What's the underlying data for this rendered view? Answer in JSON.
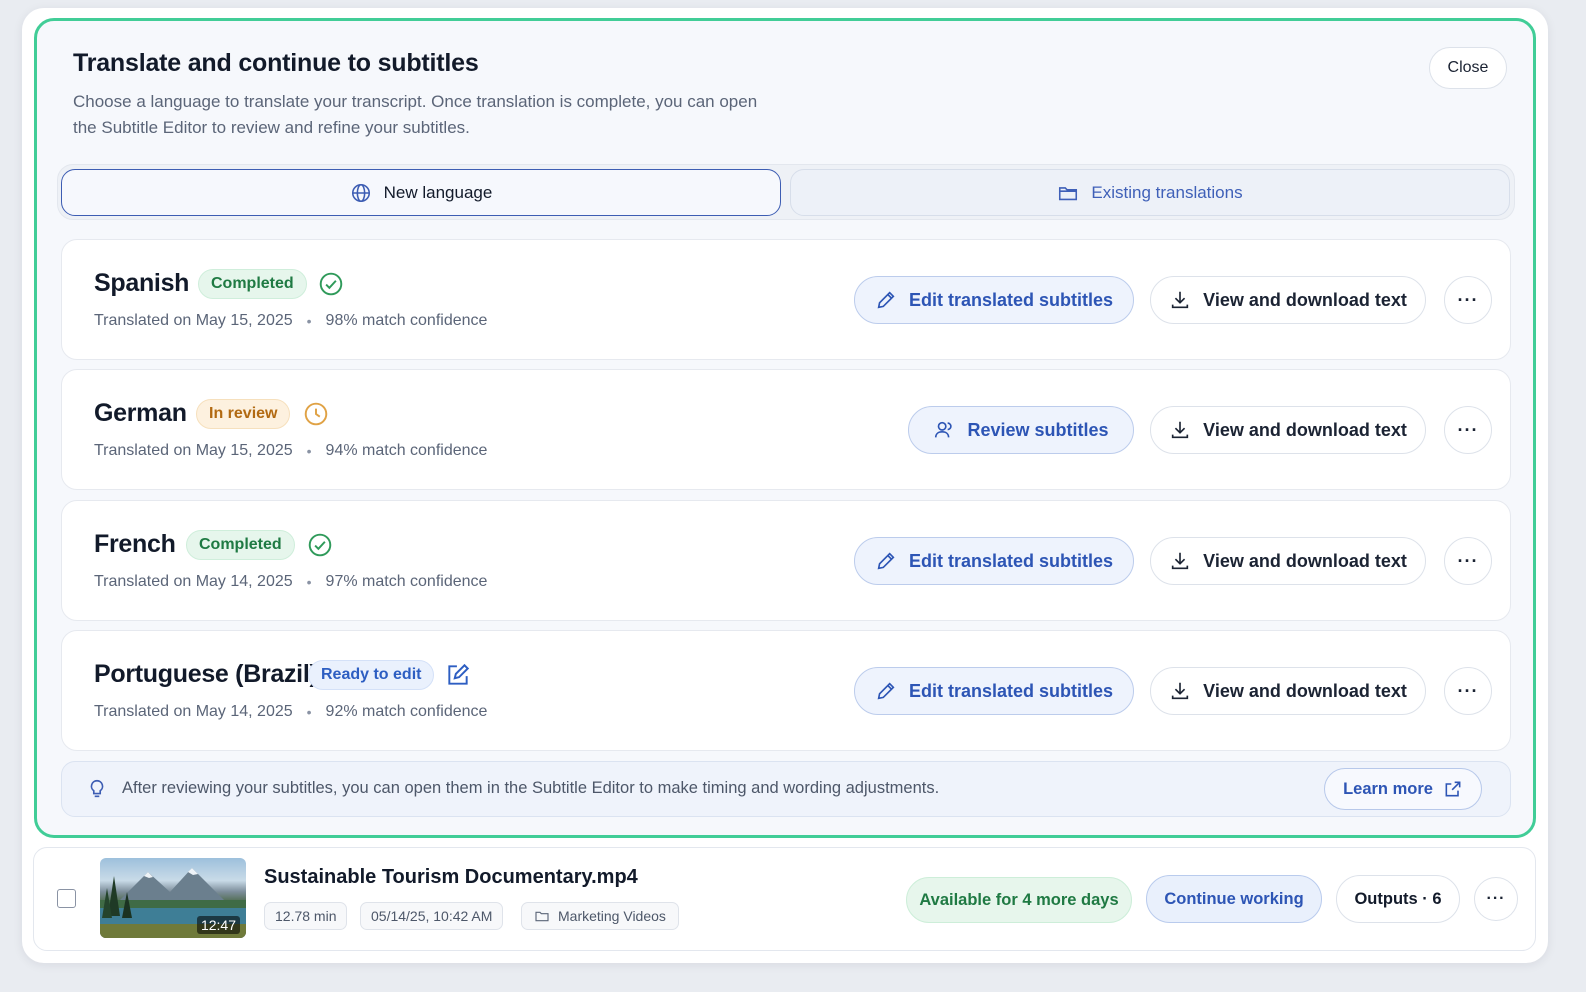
{
  "dialog": {
    "title": "Translate and continue to subtitles",
    "description": "Choose a language to translate your transcript. Once translation is complete, you can open the Subtitle Editor to review and refine your subtitles.",
    "close_label": "Close"
  },
  "tabs": [
    {
      "label": "New language",
      "icon": "globe-icon",
      "active": true
    },
    {
      "label": "Existing translations",
      "icon": "folder-icon",
      "active": false
    }
  ],
  "translations": [
    {
      "language": "Spanish",
      "status": "Completed",
      "status_icon": "check-circle-icon",
      "date": "Translated on May 15, 2025",
      "confidence": "98% match confidence",
      "primary_action": "Edit translated subtitles",
      "primary_icon": "pencil-icon",
      "secondary_action": "View and download text",
      "more": "···"
    },
    {
      "language": "German",
      "status": "In review",
      "status_icon": "clock-icon",
      "date": "Translated on May 15, 2025",
      "confidence": "94% match confidence",
      "primary_action": "Review subtitles",
      "primary_icon": "reviewer-icon",
      "secondary_action": "View and download text",
      "more": "···"
    },
    {
      "language": "French",
      "status": "Completed",
      "status_icon": "check-circle-icon",
      "date": "Translated on May 14, 2025",
      "confidence": "97% match confidence",
      "primary_action": "Edit translated subtitles",
      "primary_icon": "pencil-icon",
      "secondary_action": "View and download text",
      "more": "···"
    },
    {
      "language": "Portuguese (Brazil)",
      "status": "Ready to edit",
      "status_icon": "edit-square-icon",
      "date": "Translated on May 14, 2025",
      "confidence": "92% match confidence",
      "primary_action": "Edit translated subtitles",
      "primary_icon": "pencil-icon",
      "secondary_action": "View and download text",
      "more": "···"
    }
  ],
  "tip": {
    "text": "After reviewing your subtitles, you can open them in the Subtitle Editor to make timing and wording adjustments.",
    "link_label": "Learn more"
  },
  "file": {
    "name": "Sustainable Tourism Documentary.mp4",
    "thumb_duration": "12:47",
    "duration": "12.78 min",
    "date": "05/14/25, 10:42 AM",
    "folder": "Marketing Videos",
    "availability": "Available for 4 more days",
    "continue_label": "Continue working",
    "outputs_label": "Outputs · 6",
    "more": "···"
  },
  "colors": {
    "panel_border": "#41cd97",
    "accent_blue": "#2d55b5",
    "completed_green": "#1f7a43",
    "review_amber": "#b26a12"
  }
}
